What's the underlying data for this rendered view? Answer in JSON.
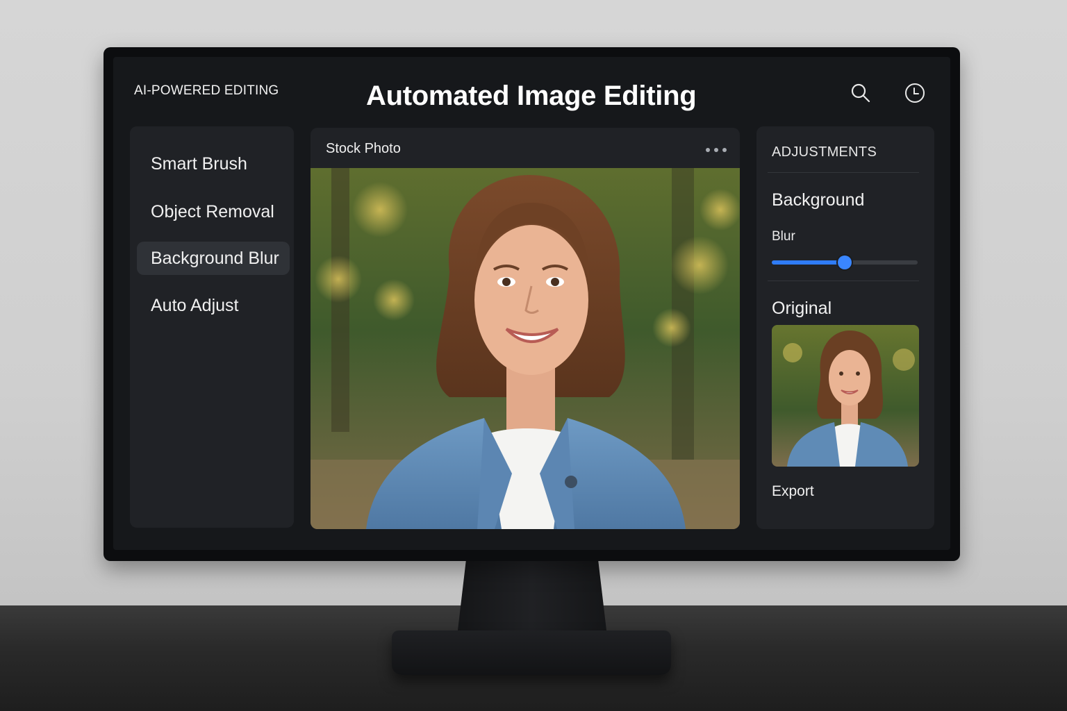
{
  "header": {
    "brand": "AI-POWERED EDITING",
    "title": "Automated Image Editing",
    "icons": [
      "search-icon",
      "history-icon"
    ]
  },
  "tools": {
    "items": [
      {
        "label": "Smart Brush",
        "active": false
      },
      {
        "label": "Object Removal",
        "active": false
      },
      {
        "label": "Background Blur",
        "active": true
      },
      {
        "label": "Auto Adjust",
        "active": false
      }
    ]
  },
  "viewer": {
    "title": "Stock Photo",
    "menu_icon": "more-horizontal-icon"
  },
  "adjustments": {
    "heading": "ADJUSTMENTS",
    "section": "Background",
    "blur_label": "Blur",
    "blur_value": 0.5,
    "original_label": "Original",
    "export_label": "Export",
    "accent_color": "#3a86ff"
  }
}
